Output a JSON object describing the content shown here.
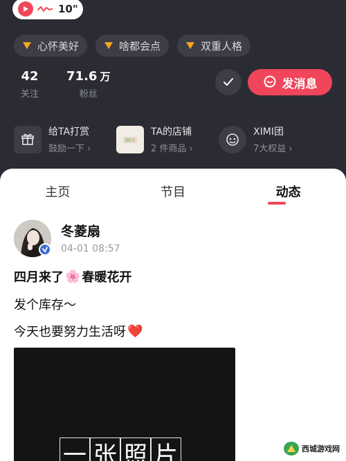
{
  "voice": {
    "duration": "10\""
  },
  "tags": [
    {
      "label": "心怀美好"
    },
    {
      "label": "啥都会点"
    },
    {
      "label": "双重人格"
    }
  ],
  "stats": {
    "following": {
      "value": "42",
      "label": "关注"
    },
    "followers": {
      "value": "71.6",
      "unit": "万",
      "label": "粉丝"
    }
  },
  "actions": {
    "message_label": "发消息"
  },
  "services": [
    {
      "title": "给TA打赏",
      "subtitle": "鼓励一下 ›",
      "icon": "gift-icon"
    },
    {
      "title": "TA的店铺",
      "subtitle": "2 件商品 ›",
      "icon": "shop-thumbnail"
    },
    {
      "title": "XIMI团",
      "subtitle": "7大权益 ›",
      "icon": "group-badge-icon"
    }
  ],
  "tabs": [
    {
      "label": "主页"
    },
    {
      "label": "节目"
    },
    {
      "label": "动态",
      "active": true
    }
  ],
  "post": {
    "author": "冬菱扇",
    "time": "04-01 08:57",
    "line1_before": "四月来了",
    "line1_emoji": "🌸",
    "line1_after": "春暖花开",
    "line2": "发个库存～",
    "line3_text": "今天也要努力生活呀",
    "line3_emoji": "❤️",
    "image_caption": [
      "一",
      "张",
      "照",
      "片"
    ]
  },
  "watermark": {
    "text": "西城游戏网"
  },
  "colors": {
    "accent": "#f0455b",
    "dark_bg": "#2b2c33",
    "chip_bg": "#3c3d45"
  }
}
